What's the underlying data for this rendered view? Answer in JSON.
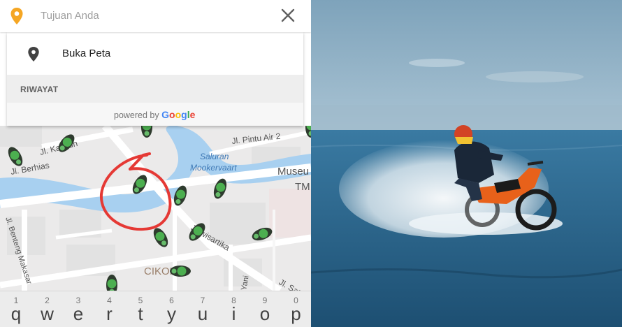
{
  "search": {
    "placeholder": "Tujuan Anda"
  },
  "icons": {
    "destination_pin": "location-pin-icon",
    "map_pin": "map-pin-icon",
    "close": "close-icon"
  },
  "suggestions": {
    "open_map_label": "Buka Peta",
    "history_header": "RIWAYAT",
    "powered_by": "powered by",
    "google_letters": [
      {
        "t": "G",
        "c": "#4285F4"
      },
      {
        "t": "o",
        "c": "#EA4335"
      },
      {
        "t": "o",
        "c": "#FBBC05"
      },
      {
        "t": "g",
        "c": "#4285F4"
      },
      {
        "t": "l",
        "c": "#34A853"
      },
      {
        "t": "e",
        "c": "#EA4335"
      }
    ]
  },
  "map": {
    "labels": {
      "jl_kalibun": "Jl. Kalibun",
      "jl_pintu_air_2": "Jl. Pintu Air 2",
      "jl_berhias": "Jl. Berhias",
      "saluran": "Saluran",
      "mookervaart": "Mookervaart",
      "museum": "Museu",
      "tm": "TM",
      "jl_wisartika": "Jl. wisartika",
      "jl_benteng": "Jl. Benteng Makasar",
      "cikoko": "CIKOKO",
      "yani": "Yani",
      "jl_satri": "Jl. Satri"
    },
    "colors": {
      "water": "#a8d0f0",
      "road": "#ffffff",
      "block": "#e3e3e3",
      "driver": "#4caf50",
      "highlight_circle": "#e53935"
    }
  },
  "keyboard": {
    "keys": [
      {
        "num": "1",
        "ch": "q"
      },
      {
        "num": "2",
        "ch": "w"
      },
      {
        "num": "3",
        "ch": "e"
      },
      {
        "num": "4",
        "ch": "r"
      },
      {
        "num": "5",
        "ch": "t"
      },
      {
        "num": "6",
        "ch": "y"
      },
      {
        "num": "7",
        "ch": "u"
      },
      {
        "num": "8",
        "ch": "i"
      },
      {
        "num": "9",
        "ch": "o"
      },
      {
        "num": "0",
        "ch": "p"
      }
    ]
  },
  "photo": {
    "subject": "motorcycle-rider-on-water",
    "colors": {
      "sky": "#8fb3cc",
      "sea": "#2f6f96",
      "spray": "#e8f0f4",
      "bike": "#e8611a"
    }
  }
}
